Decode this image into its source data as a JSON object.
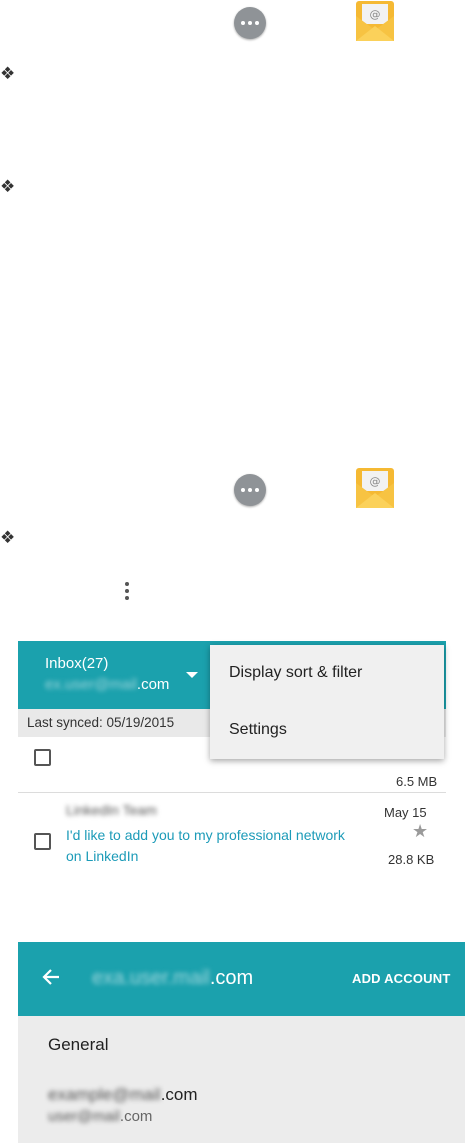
{
  "icons": {
    "apps": "apps-icon",
    "email": "email-app-icon",
    "bullet": "❖",
    "more": "more-vert-icon"
  },
  "inbox": {
    "title": "Inbox(27)",
    "account_suffix": ".com",
    "account_blurred": "ex.user@mail",
    "last_synced": "Last synced: 05/19/2015",
    "menu": [
      "Display sort & filter",
      "Settings"
    ],
    "mail1": {
      "size": "6.5 MB"
    },
    "mail2": {
      "sender_blurred": "LinkedIn Team",
      "subject": "I'd like to add you to my professional network on LinkedIn",
      "date": "May 15",
      "size": "28.8 KB"
    }
  },
  "account": {
    "title_suffix": ".com",
    "title_blurred": "exa.user.mail",
    "add_account": "ADD ACCOUNT",
    "section": "General",
    "email_line1_suffix": ".com",
    "email_line1_blurred": "example@mail",
    "email_line2_suffix": ".com",
    "email_line2_blurred": "user@mail"
  },
  "colors": {
    "teal": "#1ba1ad",
    "email_icon": "#f7b733"
  }
}
